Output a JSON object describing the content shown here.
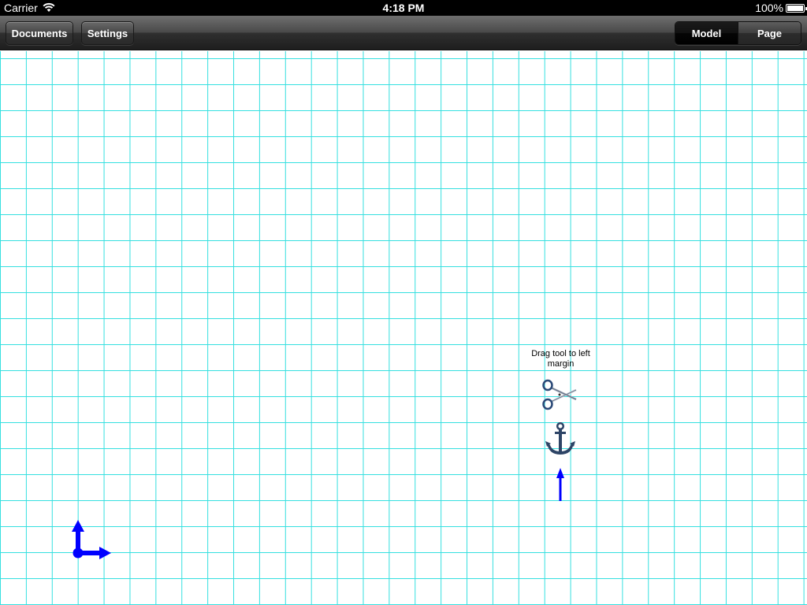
{
  "status_bar": {
    "carrier": "Carrier",
    "time": "4:18 PM",
    "battery": "100%"
  },
  "toolbar": {
    "documents_label": "Documents",
    "settings_label": "Settings",
    "segments": [
      {
        "label": "Model",
        "selected": true
      },
      {
        "label": "Page",
        "selected": false
      }
    ]
  },
  "canvas": {
    "grid_color": "#35e0e0",
    "hint": "Drag tool to left margin",
    "tools": [
      {
        "icon": "scissors-icon"
      },
      {
        "icon": "anchor-icon"
      },
      {
        "icon": "force-arrow-icon"
      }
    ],
    "axes_icon": "coordinate-axes-icon",
    "accent_color": "#0000ff"
  }
}
